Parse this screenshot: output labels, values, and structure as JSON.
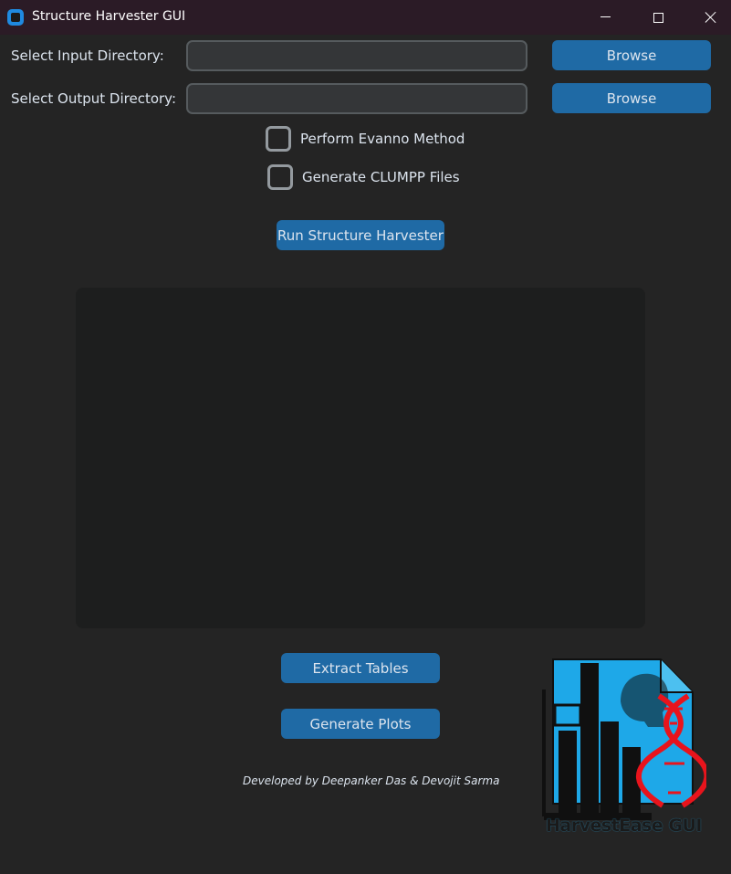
{
  "window": {
    "title": "Structure Harvester GUI"
  },
  "form": {
    "input_label": "Select Input Directory:",
    "input_value": "",
    "output_label": "Select Output Directory:",
    "output_value": "",
    "browse_input_label": "Browse",
    "browse_output_label": "Browse"
  },
  "options": {
    "evanno_label": "Perform Evanno Method",
    "evanno_checked": false,
    "clumpp_label": "Generate CLUMPP Files",
    "clumpp_checked": false
  },
  "actions": {
    "run_label": "Run Structure Harvester",
    "extract_label": "Extract Tables",
    "plots_label": "Generate Plots"
  },
  "output": {
    "text": ""
  },
  "footer": {
    "credit": "Developed by Deepanker Das & Devojit Sarma"
  },
  "logo": {
    "text": "HarvestEase GUI"
  },
  "colors": {
    "background": "#242424",
    "button": "#1f6aa5",
    "input_bg": "#343638",
    "output_bg": "#1d1e1e",
    "logo_blue": "#1ea8e8",
    "dna_red": "#e8141c"
  }
}
